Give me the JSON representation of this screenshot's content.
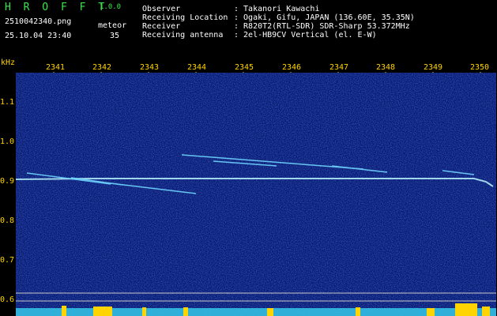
{
  "header": {
    "app_name": "H R O F F T",
    "app_version": "1.0.0",
    "filename": "2510042340.png",
    "datetime": "25.10.04 23:40",
    "meteor_label": "meteor",
    "meteor_count": "35",
    "info_keys": [
      "Observer",
      "Receiving Location",
      "Receiver",
      "Receiving antenna"
    ],
    "info_values": [
      ": Takanori Kawachi",
      ": Ogaki, Gifu, JAPAN (136.60E, 35.35N)",
      ": R820T2(RTL-SDR) SDR-Sharp 53.372MHz",
      ": 2el-HB9CV Vertical (el. E-W)"
    ]
  },
  "axis": {
    "unit": "kHz",
    "minute_labels": [
      "2341",
      "2342",
      "2343",
      "2344",
      "2345",
      "2346",
      "2347",
      "2348",
      "2349",
      "2350"
    ],
    "freq_labels": [
      "1.1",
      "1.0",
      "0.9",
      "0.8",
      "0.7",
      "0.6"
    ]
  },
  "colors": {
    "background": "#000000",
    "plot_bg": "#08186b",
    "label_yellow": "#ffd400",
    "title_green": "#39e64a",
    "carrier": "#b8f4ff"
  }
}
